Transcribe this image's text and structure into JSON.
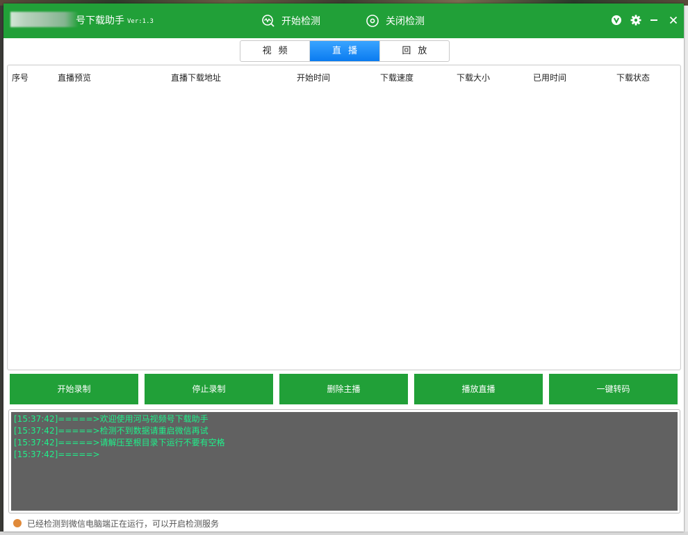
{
  "app": {
    "title": "号下载助手",
    "version": "Ver:1.3"
  },
  "toolbar": {
    "start_detect": "开始检测",
    "stop_detect": "关闭检测"
  },
  "tabs": [
    {
      "label": "视频",
      "active": false
    },
    {
      "label": "直播",
      "active": true
    },
    {
      "label": "回放",
      "active": false
    }
  ],
  "table": {
    "columns": [
      "序号",
      "直播预览",
      "直播下载地址",
      "开始时间",
      "下载速度",
      "下载大小",
      "已用时间",
      "下载状态"
    ],
    "rows": []
  },
  "buttons": {
    "start_record": "开始录制",
    "stop_record": "停止录制",
    "delete_host": "删除主播",
    "play_live": "播放直播",
    "convert": "一键转码"
  },
  "log": [
    "[15:37:42]=====>欢迎使用河马视频号下载助手",
    "[15:37:42]=====>检测不到数据请重启微信再试",
    "[15:37:42]=====>请解压至根目录下运行不要有空格",
    "[15:37:42]=====>"
  ],
  "status": {
    "text": "已经检测到微信电脑端正在运行，可以开启检测服务",
    "dot_color": "#e08a3a"
  },
  "colors": {
    "brand_green": "#21a038",
    "tab_active_blue": "#0a7bf0",
    "log_bg": "#616161",
    "log_text": "#1ff08a"
  }
}
